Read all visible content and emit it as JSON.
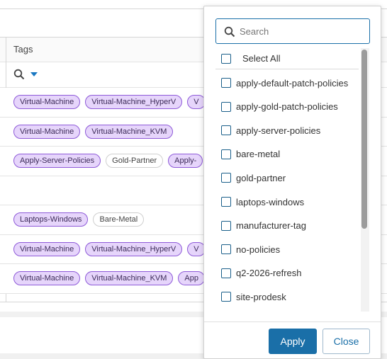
{
  "table": {
    "tags_header": "Tags",
    "rows": [
      {
        "tags": [
          {
            "text": "Virtual-Machine",
            "style": "purple"
          },
          {
            "text": "Virtual-Machine_HyperV",
            "style": "purple"
          },
          {
            "text": "V",
            "style": "purple"
          }
        ]
      },
      {
        "tags": [
          {
            "text": "Virtual-Machine",
            "style": "purple"
          },
          {
            "text": "Virtual-Machine_KVM",
            "style": "purple"
          }
        ]
      },
      {
        "tags": [
          {
            "text": "Apply-Server-Policies",
            "style": "purple"
          },
          {
            "text": "Gold-Partner",
            "style": "plain"
          },
          {
            "text": "Apply-",
            "style": "purple"
          }
        ]
      },
      {
        "tags": []
      },
      {
        "tags": [
          {
            "text": "Laptops-Windows",
            "style": "purple"
          },
          {
            "text": "Bare-Metal",
            "style": "plain"
          }
        ]
      },
      {
        "tags": [
          {
            "text": "Virtual-Machine",
            "style": "purple"
          },
          {
            "text": "Virtual-Machine_HyperV",
            "style": "purple"
          },
          {
            "text": "V",
            "style": "purple"
          }
        ]
      },
      {
        "tags": [
          {
            "text": "Virtual-Machine",
            "style": "purple"
          },
          {
            "text": "Virtual-Machine_KVM",
            "style": "purple"
          },
          {
            "text": "App",
            "style": "purple"
          }
        ]
      }
    ]
  },
  "filter_panel": {
    "search": {
      "placeholder": "Search",
      "value": ""
    },
    "select_all_label": "Select All",
    "options": [
      "apply-default-patch-policies",
      "apply-gold-patch-policies",
      "apply-server-policies",
      "bare-metal",
      "gold-partner",
      "laptops-windows",
      "manufacturer-tag",
      "no-policies",
      "q2-2026-refresh",
      "site-prodesk"
    ],
    "apply_label": "Apply",
    "close_label": "Close"
  },
  "colors": {
    "accent": "#1a6fa8",
    "tag_purple_bg": "#e6d5fb",
    "tag_purple_border": "#8e5ad8"
  },
  "icons": {
    "search": "search-icon",
    "filter_caret": "caret-down-icon"
  }
}
